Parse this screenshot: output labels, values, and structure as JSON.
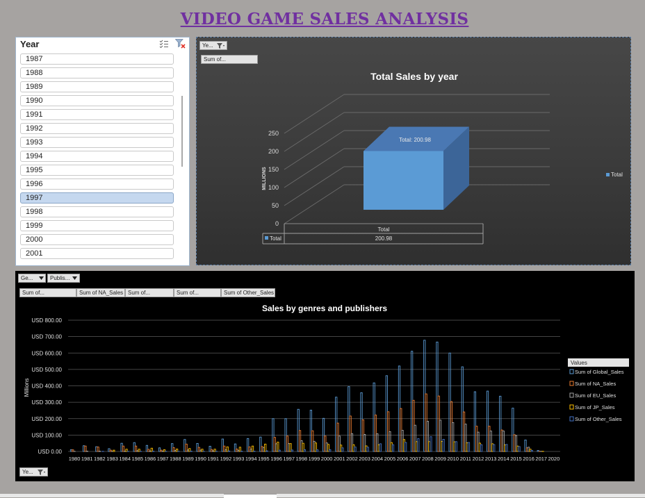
{
  "title": "VIDEO GAME SALES ANALYSIS",
  "slicer": {
    "header": "Year",
    "items": [
      "1987",
      "1988",
      "1989",
      "1990",
      "1991",
      "1992",
      "1993",
      "1994",
      "1995",
      "1996",
      "1997",
      "1998",
      "1999",
      "2000",
      "2001"
    ],
    "selected": "1997",
    "icons": [
      "multi-select-icon",
      "clear-filter-icon"
    ]
  },
  "chart1": {
    "filter_button": "Ye...",
    "value_field": "Sum of...",
    "table_header": "Total",
    "table_row_label": "Total",
    "table_value": "200.98"
  },
  "chart2": {
    "filter_buttons": [
      "Ge...",
      "Publis..."
    ],
    "value_fields": [
      "Sum of...",
      "Sum of NA_Sales",
      "Sum of...",
      "Sum of...",
      "Sum of Other_Sales"
    ],
    "axis_button": "Ye...",
    "legend_title": "Values"
  },
  "chart_data": [
    {
      "type": "bar",
      "title": "Total Sales by year",
      "ylabel": "MILLIONS",
      "categories": [
        "Total"
      ],
      "series": [
        {
          "name": "Total",
          "values": [
            200.98
          ]
        }
      ],
      "data_label": "Total:  200.98",
      "yticks": [
        "0",
        "50",
        "100",
        "150",
        "200",
        "250"
      ],
      "ylim": [
        0,
        250
      ],
      "legend": "right",
      "colors": {
        "bar": "#5b9bd5"
      }
    },
    {
      "type": "bar",
      "title": "Sales by genres and publishers",
      "ylabel": "Millions",
      "yticks": [
        "USD 0.00",
        "USD 100.00",
        "USD 200.00",
        "USD 300.00",
        "USD 400.00",
        "USD 500.00",
        "USD 600.00",
        "USD 700.00",
        "USD 800.00"
      ],
      "ylim": [
        0,
        800
      ],
      "legend": "right",
      "categories": [
        "1980",
        "1981",
        "1982",
        "1983",
        "1984",
        "1985",
        "1986",
        "1987",
        "1988",
        "1989",
        "1990",
        "1991",
        "1992",
        "1993",
        "1994",
        "1995",
        "1996",
        "1997",
        "1998",
        "1999",
        "2000",
        "2001",
        "2002",
        "2003",
        "2004",
        "2005",
        "2006",
        "2007",
        "2008",
        "2009",
        "2010",
        "2011",
        "2012",
        "2013",
        "2014",
        "2015",
        "2016",
        "2017",
        "2020"
      ],
      "series": [
        {
          "name": "Sum of Global_Sales",
          "color": "#5b9bd5",
          "values": [
            11,
            35,
            29,
            17,
            50,
            54,
            37,
            22,
            48,
            73,
            49,
            32,
            76,
            46,
            79,
            88,
            200,
            200,
            257,
            252,
            202,
            331,
            395,
            358,
            418,
            462,
            521,
            611,
            678,
            667,
            600,
            516,
            364,
            368,
            337,
            264,
            70,
            6,
            0
          ]
        },
        {
          "name": "Sum of NA_Sales",
          "color": "#ed7d31",
          "values": [
            10,
            33,
            27,
            8,
            33,
            33,
            13,
            8,
            23,
            45,
            25,
            12,
            33,
            15,
            28,
            30,
            86,
            94,
            128,
            126,
            94,
            173,
            216,
            193,
            222,
            242,
            262,
            312,
            351,
            338,
            304,
            241,
            154,
            154,
            131,
            102,
            22,
            1,
            0
          ]
        },
        {
          "name": "Sum of EU_Sales",
          "color": "#a5a5a5",
          "values": [
            1,
            2,
            2,
            1,
            2,
            5,
            3,
            2,
            6,
            9,
            8,
            4,
            11,
            7,
            14,
            24,
            47,
            48,
            66,
            62,
            52,
            94,
            109,
            104,
            108,
            121,
            129,
            160,
            184,
            191,
            176,
            167,
            118,
            125,
            125,
            97,
            26,
            1,
            0
          ]
        },
        {
          "name": "Sum of JP_Sales",
          "color": "#ffc000",
          "values": [
            0,
            0,
            0,
            8,
            14,
            14,
            20,
            11,
            15,
            18,
            14,
            14,
            28,
            26,
            33,
            45,
            57,
            48,
            50,
            52,
            43,
            39,
            41,
            34,
            41,
            54,
            73,
            60,
            60,
            61,
            59,
            53,
            51,
            47,
            40,
            33,
            14,
            1,
            0
          ]
        },
        {
          "name": "Sum of Other_Sales",
          "color": "#4472c4",
          "values": [
            0,
            0,
            1,
            0,
            1,
            1,
            2,
            1,
            1,
            2,
            1,
            1,
            3,
            2,
            2,
            4,
            8,
            9,
            11,
            10,
            11,
            22,
            27,
            26,
            47,
            41,
            55,
            78,
            90,
            74,
            60,
            55,
            41,
            42,
            43,
            30,
            7,
            0,
            0
          ]
        }
      ]
    }
  ]
}
